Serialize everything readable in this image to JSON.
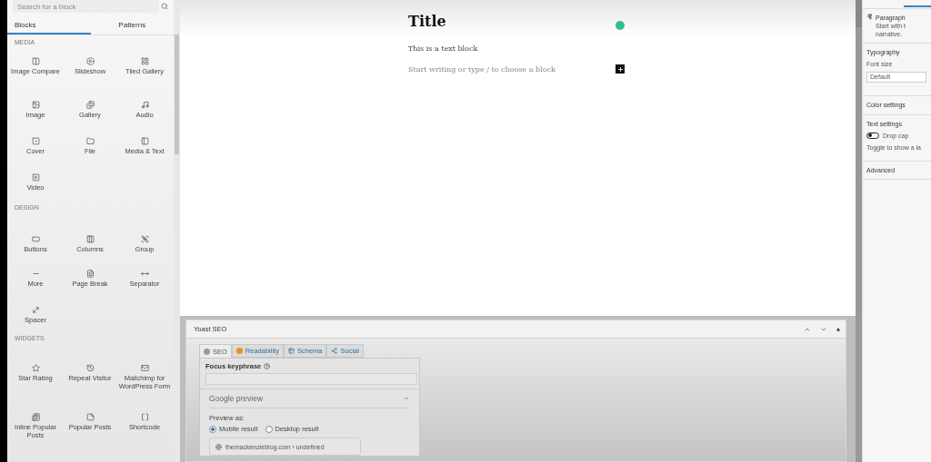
{
  "inserter": {
    "search": {
      "placeholder": "Search for a block"
    },
    "tabs": [
      {
        "label": "Blocks",
        "selected": true
      },
      {
        "label": "Patterns",
        "selected": false
      }
    ],
    "sections": [
      {
        "title": "MEDIA",
        "blocks": [
          "Image Compare",
          "Slideshow",
          "Tiled Gallery",
          "Image",
          "Gallery",
          "Audio",
          "Cover",
          "File",
          "Media & Text",
          "Video"
        ]
      },
      {
        "title": "DESIGN",
        "blocks": [
          "Buttons",
          "Columns",
          "Group",
          "More",
          "Page Break",
          "Separator",
          "Spacer"
        ]
      },
      {
        "title": "WIDGETS",
        "blocks": [
          "Star Rating",
          "Repeat Visitor",
          "Mailchimp for WordPress Form",
          "Inline Popular Posts",
          "Popular Posts",
          "Shortcode"
        ]
      }
    ]
  },
  "editor": {
    "title": "Title",
    "paragraph": "This is a text block",
    "placeholder": "Start writing or type / to choose a block"
  },
  "yoast": {
    "title": "Yoast SEO",
    "tabs": [
      {
        "label": "SEO",
        "selected": true,
        "color": "#9a9a9a"
      },
      {
        "label": "Readability",
        "selected": false,
        "color": "#e8931c"
      },
      {
        "label": "Schema",
        "selected": false
      },
      {
        "label": "Social",
        "selected": false
      }
    ],
    "focus_keyphrase": {
      "label": "Focus keyphrase"
    },
    "google_preview": {
      "title": "Google preview",
      "expanded": true,
      "preview_as": "Preview as:",
      "options": [
        {
          "label": "Mobile result",
          "selected": true
        },
        {
          "label": "Desktop result",
          "selected": false
        }
      ],
      "url": "themackenzieblog.com › undefined"
    }
  },
  "settings": {
    "block_name": "Paragraph",
    "block_desc": "Start with t",
    "block_desc_2": "narrative.",
    "typography": "Typography",
    "font_size_label": "Font size",
    "font_size": "Default",
    "color_settings": "Color settings",
    "text_settings": "Text settings",
    "drop_cap": {
      "label": "Drop cap",
      "on": false
    },
    "drop_cap_help": "Toggle to show a la",
    "advanced": "Advanced"
  }
}
